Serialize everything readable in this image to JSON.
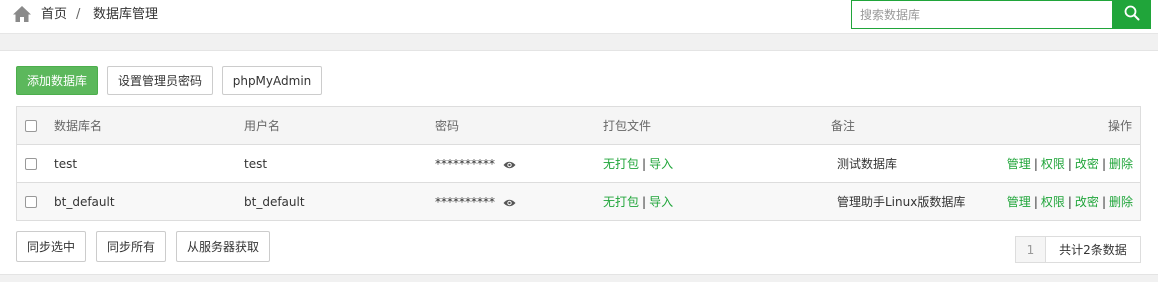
{
  "breadcrumb": {
    "home": "首页",
    "separator": "/",
    "current": "数据库管理"
  },
  "search": {
    "placeholder": "搜索数据库",
    "value": ""
  },
  "toolbar": {
    "add": "添加数据库",
    "set_root_pw": "设置管理员密码",
    "phpmyadmin": "phpMyAdmin"
  },
  "table": {
    "headers": [
      "数据库名",
      "用户名",
      "密码",
      "打包文件",
      "备注",
      "操作"
    ],
    "rows": [
      {
        "name": "test",
        "user": "test",
        "password": "**********",
        "backup": "无打包",
        "import": "导入",
        "remark": "测试数据库",
        "actions": [
          "管理",
          "权限",
          "改密",
          "删除"
        ]
      },
      {
        "name": "bt_default",
        "user": "bt_default",
        "password": "**********",
        "backup": "无打包",
        "import": "导入",
        "remark": "管理助手Linux版数据库",
        "actions": [
          "管理",
          "权限",
          "改密",
          "删除"
        ]
      }
    ]
  },
  "footer": {
    "sync_selected": "同步选中",
    "sync_all": "同步所有",
    "fetch_server": "从服务器获取"
  },
  "pagination": {
    "page": "1",
    "total": "共计2条数据"
  },
  "colors": {
    "accent": "#20a53a",
    "primary_button": "#5cb85c"
  },
  "icons": {
    "home": "home-icon",
    "search": "search-icon",
    "show_password": "eye-icon"
  }
}
